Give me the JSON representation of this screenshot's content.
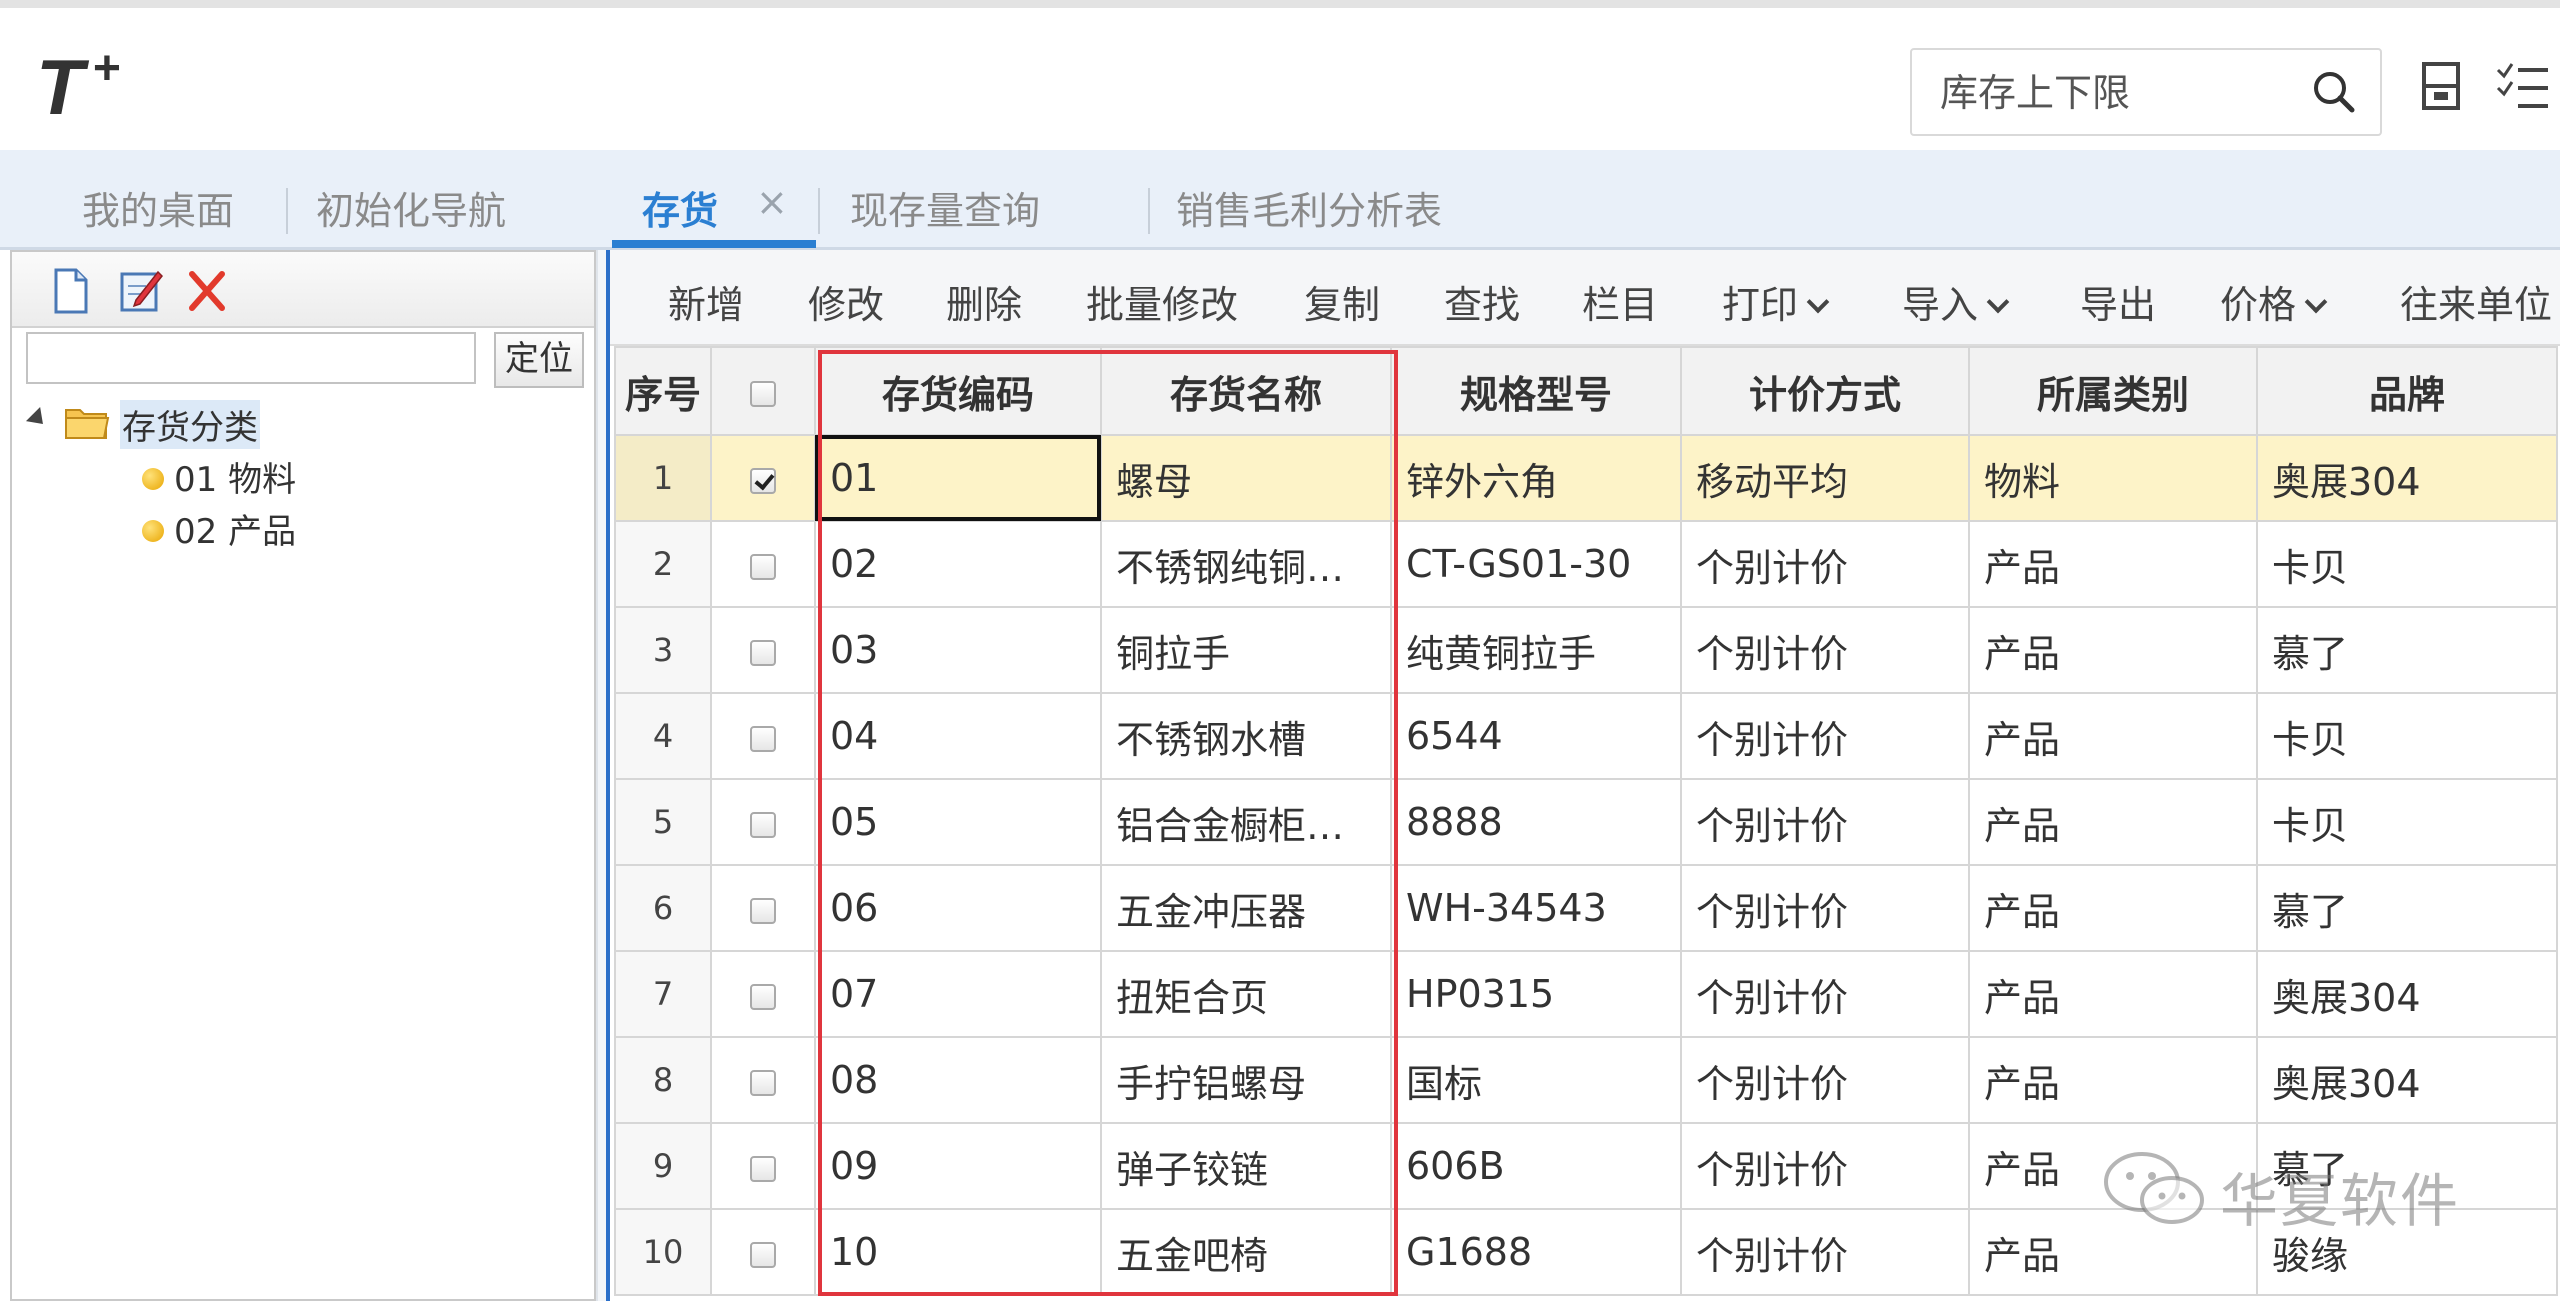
{
  "header": {
    "logo_text": "T+",
    "search_placeholder": "库存上下限"
  },
  "tabs": [
    {
      "label": "我的桌面"
    },
    {
      "label": "初始化导航"
    },
    {
      "label": "存货",
      "active": true,
      "closable": true,
      "close_glyph": "×"
    },
    {
      "label": "现存量查询"
    },
    {
      "label": "销售毛利分析表"
    }
  ],
  "left_panel": {
    "toolbar_icons": [
      "new-document-icon",
      "edit-icon",
      "delete-icon"
    ],
    "locate_button": "定位",
    "tree": {
      "root": "存货分类",
      "children": [
        "01 物料",
        "02 产品"
      ]
    }
  },
  "toolbar": {
    "items": [
      "新增",
      "修改",
      "删除",
      "批量修改",
      "复制",
      "查找",
      "栏目",
      "打印",
      "导入",
      "导出",
      "价格",
      "往来单位"
    ],
    "dropdowns": [
      "打印",
      "导入",
      "价格"
    ]
  },
  "grid": {
    "columns": [
      "序号",
      "",
      "存货编码",
      "存货名称",
      "规格型号",
      "计价方式",
      "所属类别",
      "品牌"
    ],
    "rows": [
      {
        "seq": "1",
        "checked": true,
        "code": "01",
        "name": "螺母",
        "spec": "锌外六角",
        "pricing": "移动平均",
        "category": "物料",
        "brand": "奥展304",
        "selected": true
      },
      {
        "seq": "2",
        "checked": false,
        "code": "02",
        "name": "不锈钢纯铜…",
        "spec": "CT-GS01-30",
        "pricing": "个别计价",
        "category": "产品",
        "brand": "卡贝"
      },
      {
        "seq": "3",
        "checked": false,
        "code": "03",
        "name": "铜拉手",
        "spec": "纯黄铜拉手",
        "pricing": "个别计价",
        "category": "产品",
        "brand": "慕了"
      },
      {
        "seq": "4",
        "checked": false,
        "code": "04",
        "name": "不锈钢水槽",
        "spec": "6544",
        "pricing": "个别计价",
        "category": "产品",
        "brand": "卡贝"
      },
      {
        "seq": "5",
        "checked": false,
        "code": "05",
        "name": "铝合金橱柜…",
        "spec": "8888",
        "pricing": "个别计价",
        "category": "产品",
        "brand": "卡贝"
      },
      {
        "seq": "6",
        "checked": false,
        "code": "06",
        "name": "五金冲压器",
        "spec": "WH-34543",
        "pricing": "个别计价",
        "category": "产品",
        "brand": "慕了"
      },
      {
        "seq": "7",
        "checked": false,
        "code": "07",
        "name": "扭矩合页",
        "spec": "HP0315",
        "pricing": "个别计价",
        "category": "产品",
        "brand": "奥展304"
      },
      {
        "seq": "8",
        "checked": false,
        "code": "08",
        "name": "手拧铝螺母",
        "spec": "国标",
        "pricing": "个别计价",
        "category": "产品",
        "brand": "奥展304"
      },
      {
        "seq": "9",
        "checked": false,
        "code": "09",
        "name": "弹子铰链",
        "spec": "606B",
        "pricing": "个别计价",
        "category": "产品",
        "brand": "慕了"
      },
      {
        "seq": "10",
        "checked": false,
        "code": "10",
        "name": "五金吧椅",
        "spec": "G1688",
        "pricing": "个别计价",
        "category": "产品",
        "brand": "骏缘"
      }
    ]
  },
  "watermark": {
    "text": "华夏软件",
    "icon": "wechat-icon"
  },
  "colors": {
    "accent": "#2b7fd2",
    "highlight_frame": "#e0353d",
    "selected_row": "#fdf3c8"
  }
}
